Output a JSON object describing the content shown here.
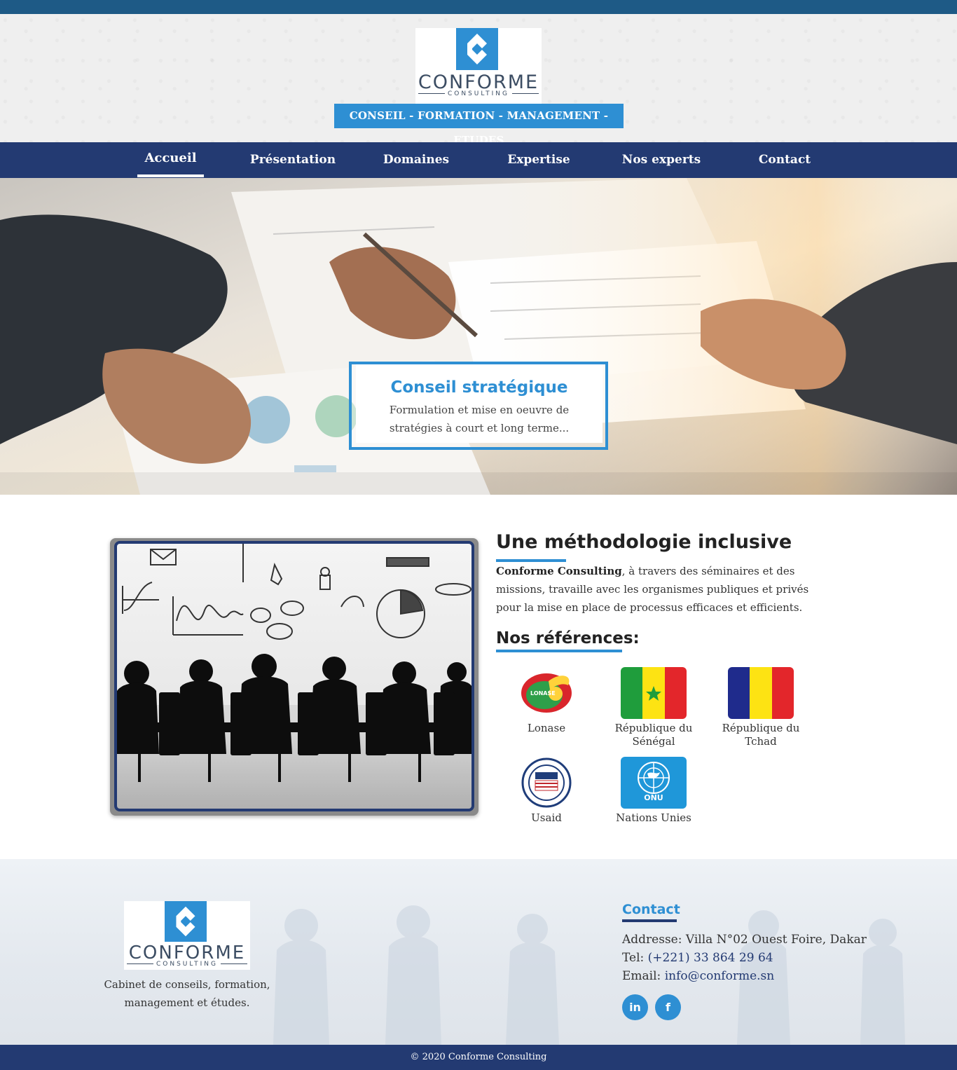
{
  "header": {
    "logo": {
      "word": "CONFORME",
      "sub": "CONSULTING"
    },
    "tagline": "CONSEIL - FORMATION - MANAGEMENT - ETUDES"
  },
  "nav": {
    "items": [
      {
        "label": "Accueil",
        "active": true
      },
      {
        "label": "Présentation"
      },
      {
        "label": "Domaines"
      },
      {
        "label": "Expertise"
      },
      {
        "label": "Nos experts"
      },
      {
        "label": "Contact"
      }
    ]
  },
  "hero": {
    "title": "Conseil stratégique",
    "text": "Formulation et mise en oeuvre de stratégies à court et long terme..."
  },
  "method": {
    "title": "Une méthodologie inclusive",
    "company": "Conforme Consulting",
    "text": ", à travers des séminaires et des missions, travaille avec les organismes publiques et privés pour la mise en place de processus efficaces et efficients."
  },
  "references": {
    "title": "Nos références:",
    "items": [
      {
        "label": "Lonase",
        "icon": "lonase-logo"
      },
      {
        "label": "République du Sénégal",
        "icon": "senegal-flag"
      },
      {
        "label": "République du Tchad",
        "icon": "chad-flag"
      },
      {
        "label": "Usaid",
        "icon": "usaid-seal"
      },
      {
        "label": "Nations Unies",
        "icon": "un-logo",
        "badge": "ONU"
      }
    ]
  },
  "footer": {
    "logo": {
      "word": "CONFORME",
      "sub": "CONSULTING"
    },
    "description": "Cabinet de conseils, formation, management et études.",
    "contact": {
      "title": "Contact",
      "address_label": "Addresse:",
      "address": "Villa N°02 Ouest Foire, Dakar",
      "tel_label": "Tel:",
      "tel": "(+221) 33 864 29 64",
      "email_label": "Email:",
      "email": "info@conforme.sn"
    },
    "social": [
      {
        "name": "linkedin",
        "glyph": "in"
      },
      {
        "name": "facebook",
        "glyph": "f"
      }
    ],
    "copyright": "© 2020 Conforme Consulting"
  },
  "colors": {
    "brand_blue": "#2e8fd3",
    "navy": "#233a72",
    "topbar": "#1e5a86"
  }
}
